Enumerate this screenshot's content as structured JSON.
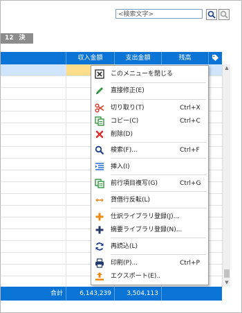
{
  "search": {
    "placeholder": "<検索文字>"
  },
  "period": {
    "month": "12",
    "label": "決算"
  },
  "table": {
    "headers": {
      "income": "収入金額",
      "expense": "支出金額",
      "balance": "残高"
    },
    "footer": {
      "total_label": "合計",
      "income_total": "6,143,239",
      "expense_total": "3,504,113"
    }
  },
  "menu": {
    "items": [
      {
        "label": "このメニューを閉じる",
        "shortcut": "",
        "icon": "close-box-icon"
      },
      {
        "label": "直接修正(E)",
        "shortcut": "",
        "icon": "pencil-icon"
      },
      {
        "label": "切り取り(T)",
        "shortcut": "Ctrl+X",
        "icon": "scissors-icon"
      },
      {
        "label": "コピー(C)",
        "shortcut": "Ctrl+C",
        "icon": "copy-icon"
      },
      {
        "label": "削除(D)",
        "shortcut": "",
        "icon": "delete-x-icon"
      },
      {
        "label": "検索(F)...",
        "shortcut": "Ctrl+F",
        "icon": "magnifier-icon"
      },
      {
        "label": "挿入(I)",
        "shortcut": "",
        "icon": "insert-lines-icon"
      },
      {
        "label": "前行項目複写(G)",
        "shortcut": "Ctrl+G",
        "icon": "copy-icon"
      },
      {
        "label": "貸借行反転(L)",
        "shortcut": "",
        "icon": "swap-arrows-icon"
      },
      {
        "label": "仕訳ライブラリ登録(J)...",
        "shortcut": "",
        "icon": "plus-orange-icon"
      },
      {
        "label": "摘要ライブラリ登録(N)...",
        "shortcut": "",
        "icon": "plus-navy-icon"
      },
      {
        "label": "再読込(L)",
        "shortcut": "",
        "icon": "refresh-icon"
      },
      {
        "label": "印刷(P)...",
        "shortcut": "Ctrl+P",
        "icon": "printer-icon"
      },
      {
        "label": "エクスポート(E)..",
        "shortcut": "",
        "icon": "export-icon"
      }
    ]
  },
  "colors": {
    "header_blue": "#0a74d6",
    "selected_row": "#cfe5fb",
    "selected_cell": "#ffdd8a"
  }
}
